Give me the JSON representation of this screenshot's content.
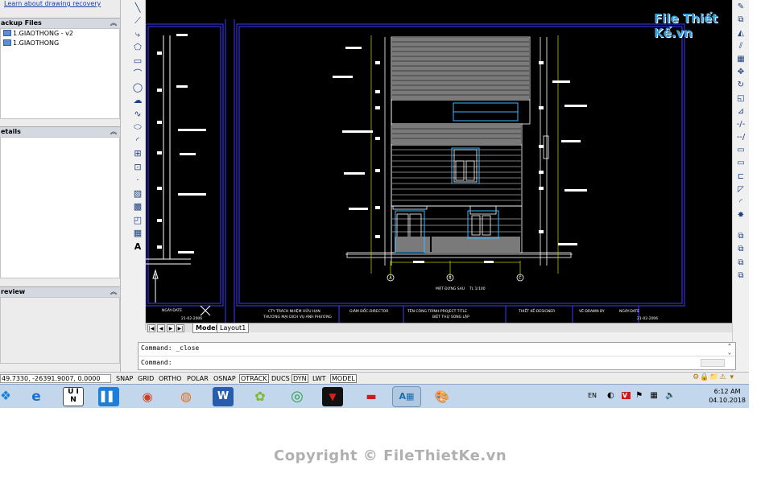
{
  "left_panel": {
    "recovery_link": "Learn about drawing recovery",
    "backup_section": "ackup Files",
    "backup_files": [
      "1.GIAOTHONG - v2",
      "1.GIAOTHONG"
    ],
    "details_section": "etails",
    "preview_section": "review"
  },
  "layout_tabs": [
    "Model",
    "Layout1"
  ],
  "active_tab": "Model",
  "command_line": {
    "line1": "Command:  _close",
    "line2": "Command:"
  },
  "status_bar": {
    "coords": "49.7330, -26391.9007, 0.0000",
    "toggles": [
      {
        "label": "SNAP",
        "on": false
      },
      {
        "label": "GRID",
        "on": false
      },
      {
        "label": "ORTHO",
        "on": false
      },
      {
        "label": "POLAR",
        "on": false
      },
      {
        "label": "OSNAP",
        "on": false
      },
      {
        "label": "OTRACK",
        "on": true
      },
      {
        "label": "DUCS",
        "on": false
      },
      {
        "label": "DYN",
        "on": true
      },
      {
        "label": "LWT",
        "on": false
      },
      {
        "label": "MODEL",
        "on": true
      }
    ]
  },
  "drawing": {
    "elevation_title": "MẶT ĐỨNG SAU",
    "scale": "TL 1/100",
    "company": "CTY TRÁCH NHIỆM HỮU HẠN",
    "company_line2": "THƯƠNG MẠI DỊCH VỤ ANH PHƯƠNG",
    "director": "GIÁM ĐỐC-DIRECTOR",
    "project_title": "TÊN CÔNG TRÌNH-PROJECT TITLE",
    "project_name": "BIỆT THỰ SONG LẬP",
    "designer": "THIẾT KẾ-DESIGNER",
    "drawn_by": "VẼ-DRAWN BY",
    "date_label": "NGÀY-DATE",
    "date_value": "21-02-2006",
    "date_left": "21-02-2006",
    "left_label": "NGÀY-DATE",
    "axis_labels": [
      "A",
      "B",
      "C"
    ]
  },
  "taskbar": {
    "apps": [
      "windows-start",
      "internet-explorer",
      "unikey",
      "file-explorer",
      "snagit",
      "firefox",
      "word",
      "corel",
      "chrome",
      "arkzone",
      "archive",
      "autocad",
      "paint"
    ],
    "lang": "EN",
    "time": "6:12 AM",
    "date": "04.10.2018"
  },
  "watermark": "Copyright © FileThietKe.vn",
  "logo": "File Thiết Kế.vn"
}
